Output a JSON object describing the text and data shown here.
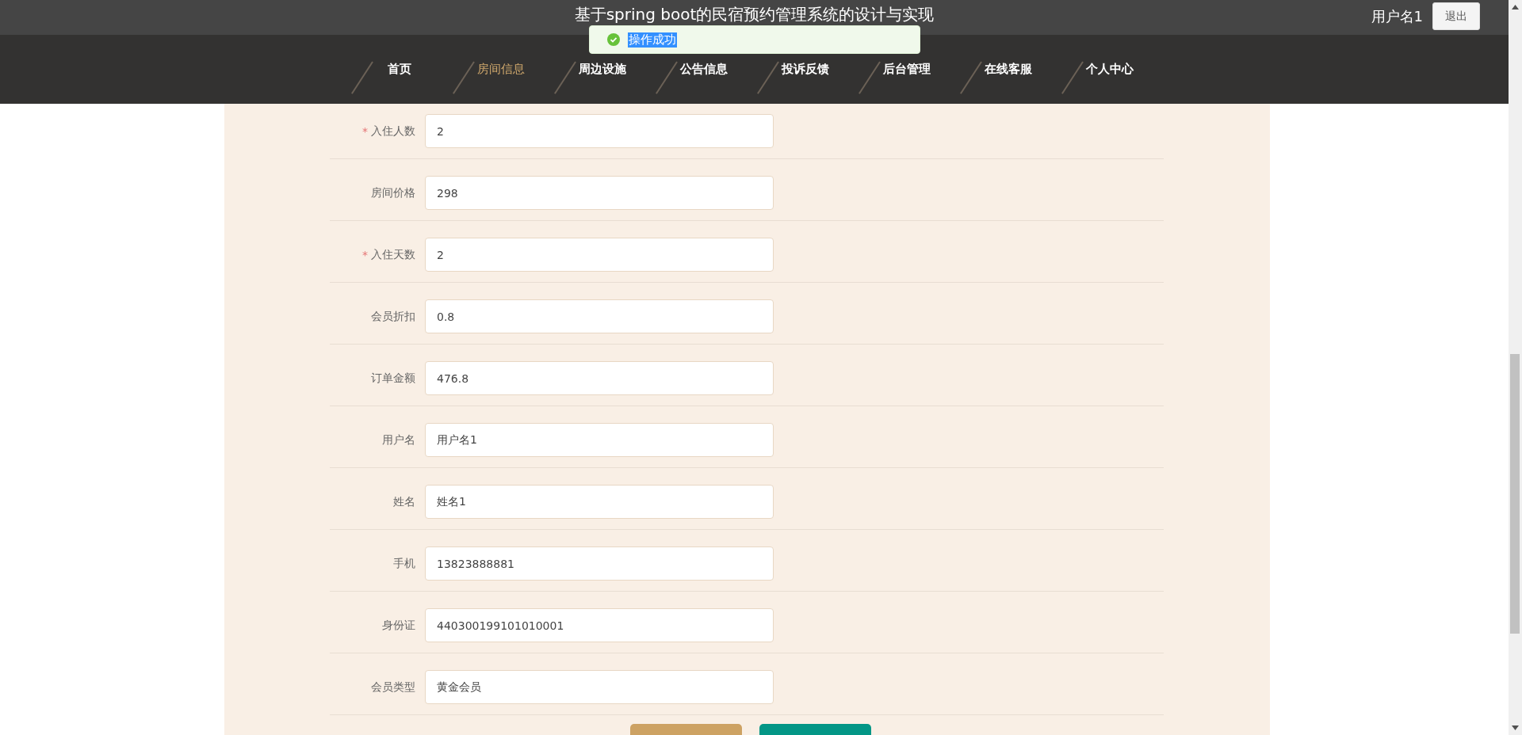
{
  "header": {
    "title": "基于spring boot的民宿预约管理系统的设计与实现",
    "username": "用户名1",
    "logout": "退出"
  },
  "nav": [
    {
      "label": "首页",
      "selected": false
    },
    {
      "label": "房间信息",
      "selected": true
    },
    {
      "label": "周边设施",
      "selected": false
    },
    {
      "label": "公告信息",
      "selected": false
    },
    {
      "label": "投诉反馈",
      "selected": false
    },
    {
      "label": "后台管理",
      "selected": false
    },
    {
      "label": "在线客服",
      "selected": false
    },
    {
      "label": "个人中心",
      "selected": false
    }
  ],
  "toast": {
    "message": "操作成功"
  },
  "required_symbol": "*",
  "form": [
    {
      "label": "入住人数",
      "value": "2",
      "required": true
    },
    {
      "label": "房间价格",
      "value": "298",
      "required": false
    },
    {
      "label": "入住天数",
      "value": "2",
      "required": true
    },
    {
      "label": "会员折扣",
      "value": "0.8",
      "required": false
    },
    {
      "label": "订单金额",
      "value": "476.8",
      "required": false
    },
    {
      "label": "用户名",
      "value": "用户名1",
      "required": false
    },
    {
      "label": "姓名",
      "value": "姓名1",
      "required": false
    },
    {
      "label": "手机",
      "value": "13823888881",
      "required": false
    },
    {
      "label": "身份证",
      "value": "440300199101010001",
      "required": false
    },
    {
      "label": "会员类型",
      "value": "黄金会员",
      "required": false
    }
  ]
}
